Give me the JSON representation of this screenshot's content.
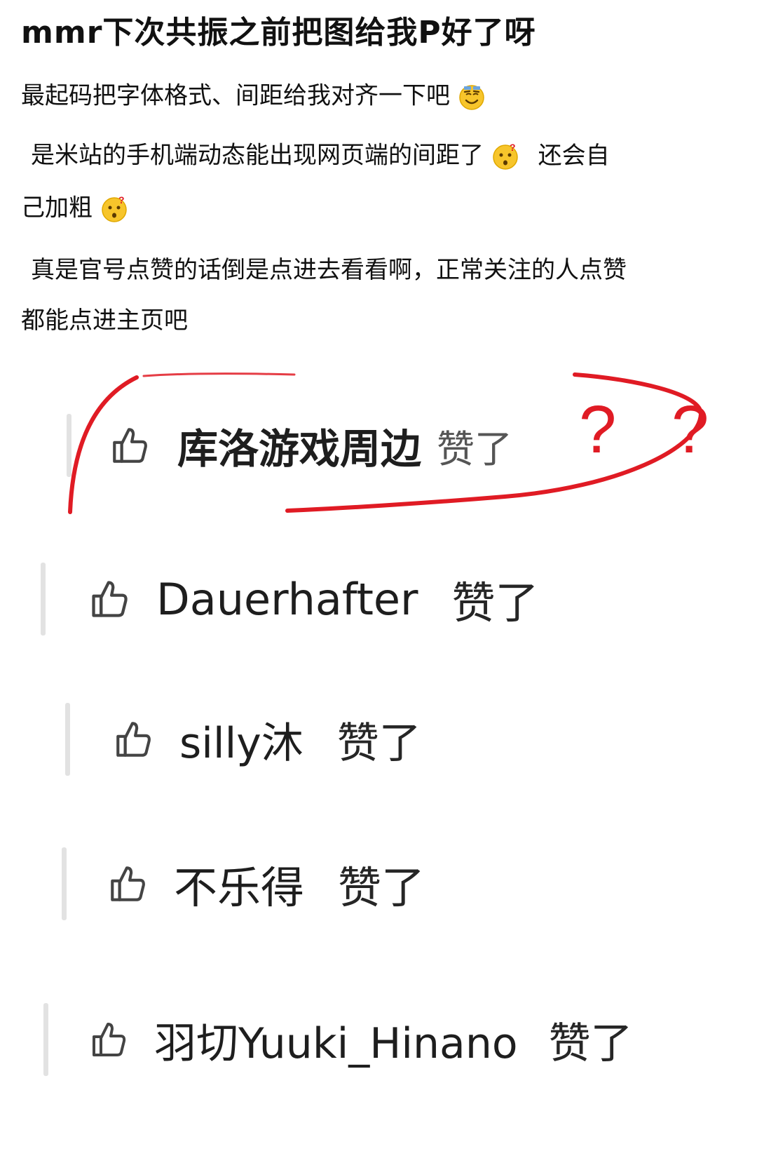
{
  "post": {
    "title": "mmr下次共振之前把图给我P好了呀",
    "line1": "最起码把字体格式、间距给我对齐一下吧",
    "line2a": "是米站的手机端动态能出现网页端的间距了",
    "line2b": "还会自",
    "line2c": "己加粗",
    "line3a": "真是官号点赞的话倒是点进去看看啊，正常关注的人点赞",
    "line3b": "都能点进主页吧"
  },
  "emojis": [
    "smile-emoji",
    "confused-emoji",
    "confused-emoji"
  ],
  "likes": [
    {
      "name": "库洛游戏周边",
      "suffix": "赞了"
    },
    {
      "name": "Dauerhafter",
      "suffix": "赞了"
    },
    {
      "name": "silly沐",
      "suffix": "赞了"
    },
    {
      "name": "不乐得",
      "suffix": "赞了"
    },
    {
      "name": "羽切Yuuki_Hinano",
      "suffix": "赞了"
    }
  ],
  "annotation": {
    "marks": [
      "?",
      "?"
    ],
    "color": "#e01b24"
  }
}
